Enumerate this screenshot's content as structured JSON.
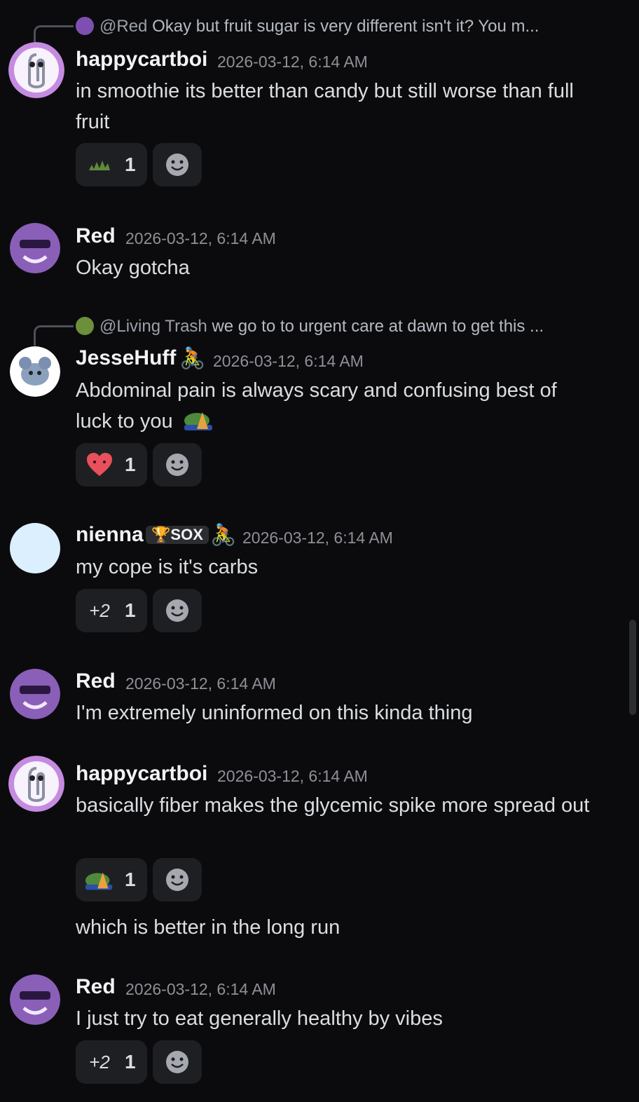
{
  "messages": [
    {
      "reply": {
        "mention": "@Red",
        "text": "Okay but fruit sugar is very different isn't it? You m..."
      },
      "username": "happycartboi",
      "timestamp": "2026-03-12, 6:14 AM",
      "lines": [
        "in smoothie its better than candy but still worse than full fruit"
      ],
      "reaction": {
        "emoji": "grass-emoji",
        "count": "1"
      }
    },
    {
      "username": "Red",
      "timestamp": "2026-03-12, 6:14 AM",
      "lines": [
        "Okay gotcha"
      ]
    },
    {
      "reply": {
        "mention": "@Living Trash",
        "text": "we go to to urgent care at dawn to get this ..."
      },
      "username": "JesseHuff",
      "timestamp": "2026-03-12, 6:14 AM",
      "lines": [
        "Abdominal pain is always scary and confusing best of luck to you"
      ],
      "reaction": {
        "emoji": "heart-face-emoji",
        "count": "1"
      }
    },
    {
      "username": "nienna",
      "badge": "SOX",
      "timestamp": "2026-03-12, 6:14 AM",
      "lines": [
        "my cope is it's carbs"
      ],
      "reaction": {
        "emoji": "+2",
        "count": "1"
      }
    },
    {
      "username": "Red",
      "timestamp": "2026-03-12, 6:14 AM",
      "lines": [
        "I'm extremely uninformed on this kinda thing"
      ]
    },
    {
      "username": "happycartboi",
      "timestamp": "2026-03-12, 6:14 AM",
      "lines": [
        "basically fiber makes the glycemic spike more spread out"
      ],
      "reaction": {
        "emoji": "frog-cone-emoji",
        "count": "1"
      },
      "followup": "which is better in the long run"
    },
    {
      "username": "Red",
      "timestamp": "2026-03-12, 6:14 AM",
      "lines": [
        "I just try to eat generally healthy by vibes"
      ],
      "reaction": {
        "emoji": "+2",
        "count": "1"
      }
    }
  ],
  "colors": {
    "background": "#0b0b0e",
    "reaction_bg": "#1e1f22",
    "username": "#f2f3f5",
    "text": "#dbdee1",
    "timestamp": "#8e9096"
  }
}
